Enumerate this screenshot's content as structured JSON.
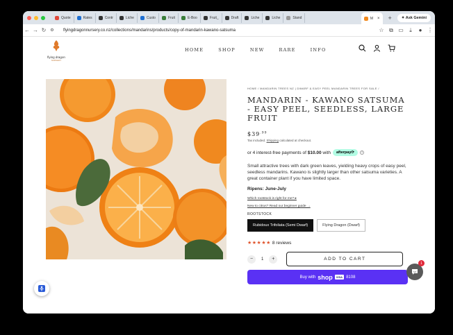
{
  "browser": {
    "tabs": [
      {
        "label": "Quote",
        "color": "#e0483a"
      },
      {
        "label": "Rates",
        "color": "#1f6fd1"
      },
      {
        "label": "Contr",
        "color": "#333333"
      },
      {
        "label": "Liche",
        "color": "#333333"
      },
      {
        "label": "Custo",
        "color": "#1f6fd1"
      },
      {
        "label": "Fruit",
        "color": "#3a7d3a"
      },
      {
        "label": "E-Boo",
        "color": "#3a7d3a"
      },
      {
        "label": "Fruit_",
        "color": "#333333"
      },
      {
        "label": "Draft",
        "color": "#333333"
      },
      {
        "label": "Liche",
        "color": "#333333"
      },
      {
        "label": "Liche",
        "color": "#333333"
      },
      {
        "label": "Stand",
        "color": "#999999"
      }
    ],
    "active_tab": {
      "label": "M",
      "close": "×"
    },
    "new_tab": "+",
    "ask_gemini": "✦ Ask Gemini",
    "url": "flyingdragonnursery.co.nz/collections/mandarins/products/copy-of-mandarin-kawano-satsuma"
  },
  "site": {
    "logo_text": "flying dragon",
    "logo_sub": "NURSERY",
    "nav": [
      "HOME",
      "SHOP",
      "NEW",
      "RARE",
      "INFO"
    ]
  },
  "product": {
    "breadcrumb": "HOME / MANDARIN TREES NZ | DWARF & EASY PEEL MANDARIN TREES FOR SALE /",
    "title": "MANDARIN - KAWANO SATSUMA - EASY PEEL, SEEDLESS, LARGE FRUIT",
    "price_main": "$39",
    "price_cents": ".99",
    "tax_prefix": "Tax included. ",
    "tax_link": "Shipping",
    "tax_suffix": " calculated at checkout.",
    "afterpay_text": "or 4 interest-free payments of ",
    "afterpay_amount": "$10.00",
    "afterpay_with": " with",
    "afterpay_badge": "afterpay⟳",
    "afterpay_info": "i",
    "description": "Small attractive trees with dark green leaves, yielding heavy crops of easy peel, seedless mandarins. Kawano is slightly larger than other satsuma varieties. A great container plant if you have limited space.",
    "ripens": "Ripens: June-July",
    "link_rootstock": "Which rootstock is right for me? ▸",
    "link_citrus": "New to citrus? Read our beginner guide →",
    "rootstock_label": "ROOTSTOCK",
    "variants": [
      "Rubidoux Trifoliata (Semi Dwarf)",
      "Flying Dragon (Dwarf)"
    ],
    "stars": "★★★★★",
    "reviews": "8 reviews",
    "qty_minus": "−",
    "quantity": "1",
    "qty_plus": "+",
    "add_to_cart": "ADD TO CART",
    "shoppay_prefix": "Buy with",
    "shoppay_brand": "shop",
    "shoppay_card": "VISA",
    "shoppay_last4": "8108"
  },
  "chat_badge": "1",
  "colors": {
    "shop_pay": "#5a31f4",
    "stars": "#e0542c",
    "afterpay": "#b2fce4",
    "orange": "#f28a1e"
  }
}
